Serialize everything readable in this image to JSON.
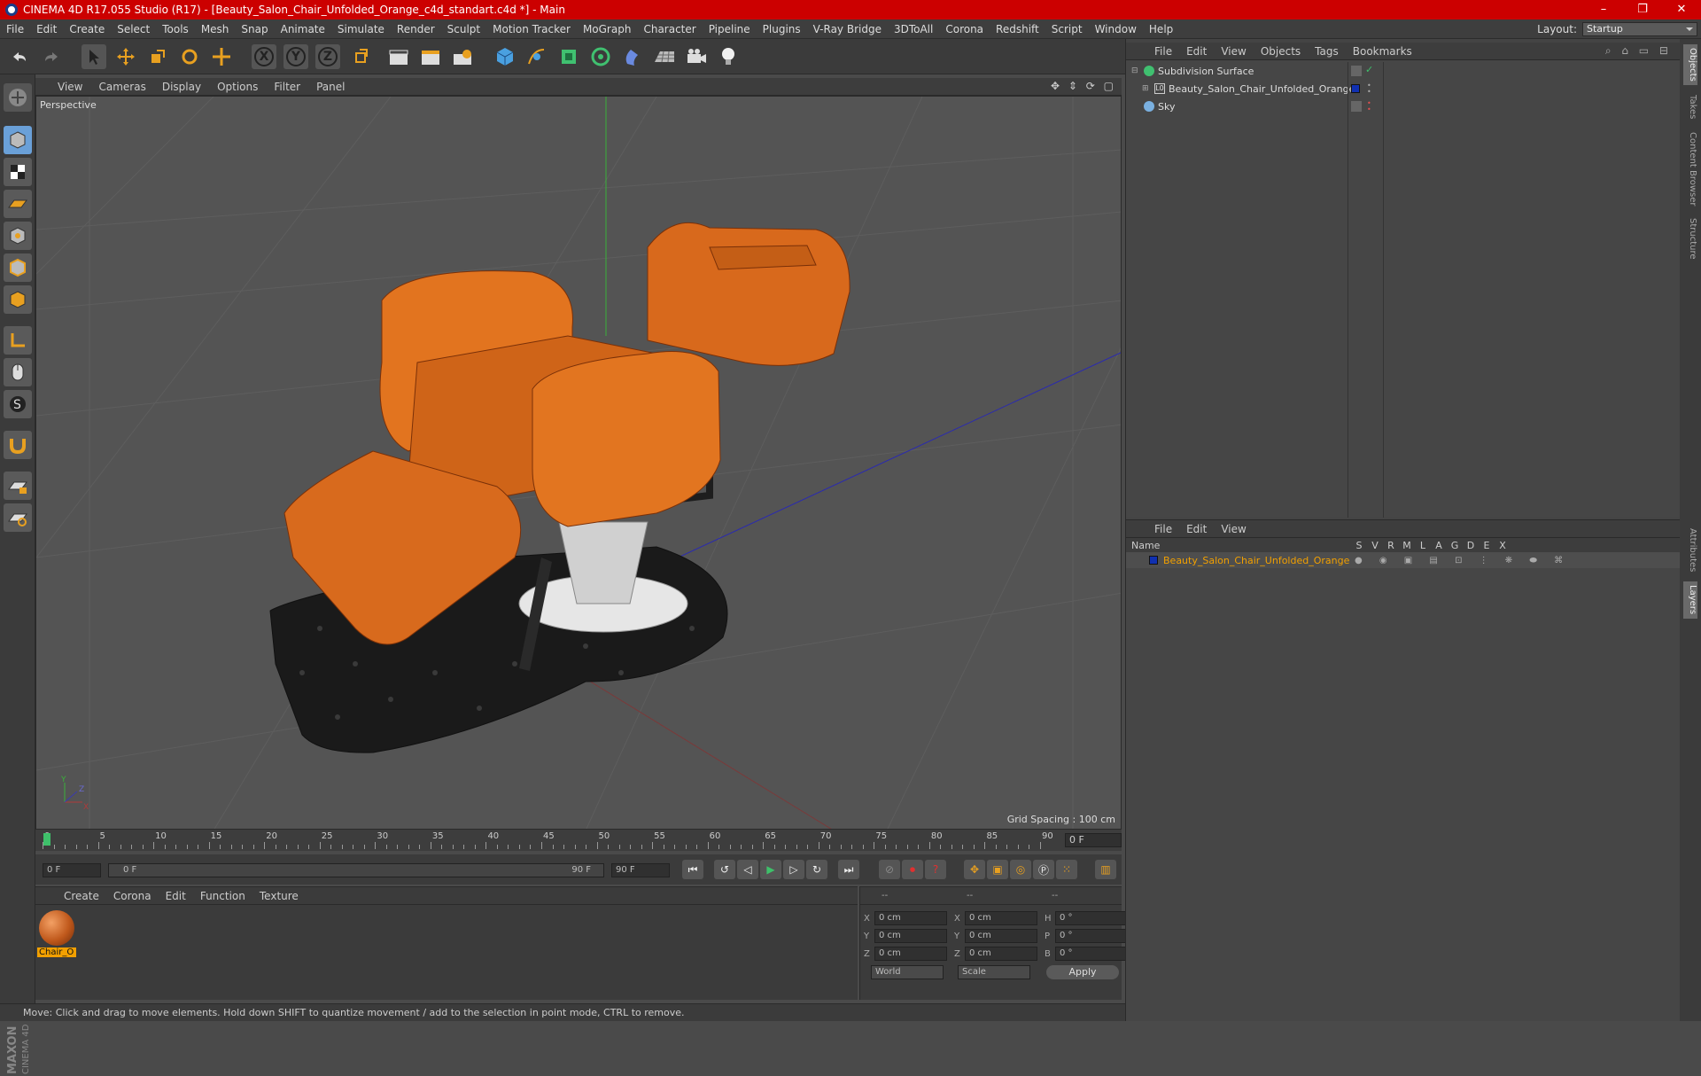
{
  "window": {
    "title": "CINEMA 4D R17.055 Studio (R17) - [Beauty_Salon_Chair_Unfolded_Orange_c4d_standart.c4d *] - Main",
    "controls": [
      "–",
      "❐",
      "✕"
    ]
  },
  "menubar": {
    "items": [
      "File",
      "Edit",
      "Create",
      "Select",
      "Tools",
      "Mesh",
      "Snap",
      "Animate",
      "Simulate",
      "Render",
      "Sculpt",
      "Motion Tracker",
      "MoGraph",
      "Character",
      "Pipeline",
      "Plugins",
      "V-Ray Bridge",
      "3DToAll",
      "Corona",
      "Redshift",
      "Script",
      "Window",
      "Help"
    ],
    "layout_label": "Layout:",
    "layout_value": "Startup"
  },
  "toolbar": {
    "axis_buttons": [
      "X",
      "Y",
      "Z"
    ]
  },
  "viewport": {
    "menu": [
      "View",
      "Cameras",
      "Display",
      "Options",
      "Filter",
      "Panel"
    ],
    "label": "Perspective",
    "grid_spacing": "Grid Spacing : 100 cm",
    "axis_labels": [
      "Y",
      "Z",
      "X"
    ]
  },
  "timeline": {
    "ticks": [
      "0",
      "5",
      "10",
      "15",
      "20",
      "25",
      "30",
      "35",
      "40",
      "45",
      "50",
      "55",
      "60",
      "65",
      "70",
      "75",
      "80",
      "85",
      "90"
    ],
    "current_frame": "0 F"
  },
  "playbar": {
    "start_field": "0 F",
    "range_start": "0 F",
    "range_end": "90 F",
    "end_field": "90 F"
  },
  "material_panel": {
    "menu": [
      "Create",
      "Corona",
      "Edit",
      "Function",
      "Texture"
    ],
    "material_name": "Chair_O"
  },
  "attributes": {
    "header": [
      "--",
      "--",
      "--"
    ],
    "rows": [
      {
        "a": "X",
        "av": "0 cm",
        "b": "X",
        "bv": "0 cm",
        "c": "H",
        "cv": "0 °"
      },
      {
        "a": "Y",
        "av": "0 cm",
        "b": "Y",
        "bv": "0 cm",
        "c": "P",
        "cv": "0 °"
      },
      {
        "a": "Z",
        "av": "0 cm",
        "b": "Z",
        "bv": "0 cm",
        "c": "B",
        "cv": "0 °"
      }
    ],
    "coord_system": "World",
    "mode": "Scale",
    "apply_label": "Apply"
  },
  "statusbar": {
    "text": "Move: Click and drag to move elements. Hold down SHIFT to quantize movement / add to the selection in point mode, CTRL to remove."
  },
  "object_manager": {
    "menu": [
      "File",
      "Edit",
      "View",
      "Objects",
      "Tags",
      "Bookmarks"
    ],
    "objects": [
      {
        "name": "Subdivision Surface"
      },
      {
        "name": "Beauty_Salon_Chair_Unfolded_Orange"
      },
      {
        "name": "Sky"
      }
    ]
  },
  "layer_manager": {
    "menu": [
      "File",
      "Edit",
      "View"
    ],
    "columns": [
      "Name",
      "S",
      "V",
      "R",
      "M",
      "L",
      "A",
      "G",
      "D",
      "E",
      "X"
    ],
    "layers": [
      {
        "name": "Beauty_Salon_Chair_Unfolded_Orange",
        "color": "#1030b0"
      }
    ]
  },
  "side_tabs": [
    "Objects",
    "Takes",
    "Content Browser",
    "Structure",
    "Attributes",
    "Layers"
  ],
  "brand": {
    "logo_text": "MAXON CINEMA 4D"
  },
  "colors": {
    "accent": "#cc0000",
    "selection": "#f2a000",
    "chair": "#d8691c"
  }
}
